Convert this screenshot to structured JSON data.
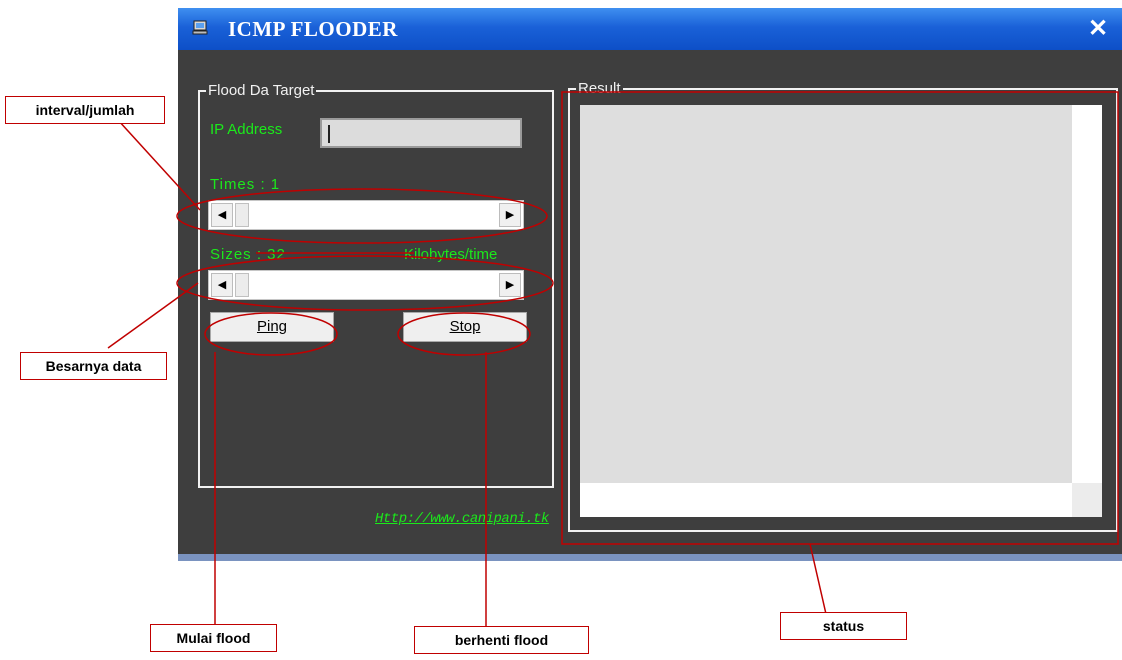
{
  "window": {
    "title": "ICMP FLOODER",
    "close_label": "✕"
  },
  "target_group": {
    "label": "Flood Da Target",
    "ip_label": "IP Address",
    "ip_value": "",
    "times_label": "Times : 1",
    "sizes_label": "Sizes : 32",
    "sizes_unit": "Kilobytes/time",
    "ping_label": "Ping",
    "stop_label": "Stop"
  },
  "result_group": {
    "label": "Result"
  },
  "footer": {
    "link_text": "Http://www.canipani.tk"
  },
  "annotations": {
    "interval": "interval/jumlah",
    "data_size": "Besarnya data",
    "start": "Mulai flood",
    "stop": "berhenti flood",
    "status": "status"
  },
  "colors": {
    "window_bg": "#3e3e3e",
    "label_green": "#1be91b",
    "annotation_red": "#c00000",
    "titlebar_blue": "#1a61d8"
  }
}
